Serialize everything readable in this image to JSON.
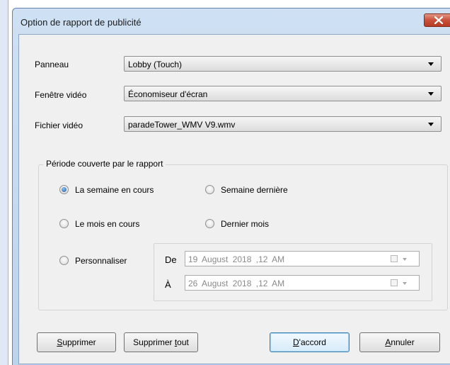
{
  "window": {
    "title": "Option de rapport de publicité"
  },
  "form": {
    "panneau_label": "Panneau",
    "panneau_value": "Lobby (Touch)",
    "fenetre_label": "Fenêtre vidéo",
    "fenetre_value": "Économiseur d'écran",
    "fichier_label": "Fichier vidéo",
    "fichier_value": "paradeTower_WMV V9.wmv"
  },
  "period": {
    "legend": "Période couverte par le rapport",
    "options": [
      {
        "label": "La semaine en cours",
        "selected": true
      },
      {
        "label": "Semaine dernière",
        "selected": false
      },
      {
        "label": "Le mois en cours",
        "selected": false
      },
      {
        "label": "Dernier mois",
        "selected": false
      },
      {
        "label": "Personnaliser",
        "selected": false
      }
    ],
    "from_label": "De",
    "from_value": "19  August  2018 ,12 AM",
    "to_label": "À",
    "to_value": "26  August  2018 ,12 AM"
  },
  "buttons": {
    "delete_mnemonic": "S",
    "delete_rest": "upprimer",
    "delete_all_prefix": "Supprimer ",
    "delete_all_mnemonic": "t",
    "delete_all_rest": "out",
    "ok_mnemonic": "D",
    "ok_rest": "'accord",
    "cancel_mnemonic": "A",
    "cancel_rest": "nnuler"
  },
  "colors": {
    "close_button": "#c9503a",
    "selected_radio": "#1e5f9e",
    "default_button_border": "#3c7fb1"
  }
}
